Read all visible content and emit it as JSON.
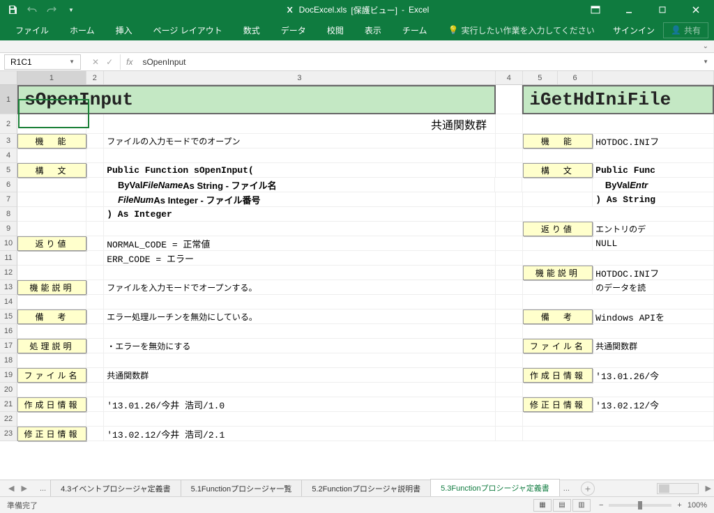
{
  "title": {
    "file": "DocExcel.xls",
    "mode": "[保護ビュー]",
    "app": "Excel"
  },
  "ribbon": {
    "file": "ファイル",
    "home": "ホーム",
    "insert": "挿入",
    "layout": "ページ レイアウト",
    "formulas": "数式",
    "data": "データ",
    "review": "校閲",
    "view": "表示",
    "team": "チーム",
    "tellme": "実行したい作業を入力してください",
    "signin": "サインイン",
    "share": "共有"
  },
  "nameBox": "R1C1",
  "formula": "sOpenInput",
  "cols": [
    "1",
    "2",
    "3",
    "4",
    "5",
    "6"
  ],
  "left": {
    "header": "sOpenInput",
    "sub": "共通関数群",
    "labels": {
      "kinou": "機　能",
      "koubun": "構　文",
      "modori": "返り値",
      "kinousetsumei": "機能説明",
      "bikou": "備　考",
      "shorisetsumei": "処理説明",
      "filename": "ファイル名",
      "sakusei": "作成日情報",
      "shusei": "修正日情報"
    },
    "r3": "ファイルの入力モードでのオープン",
    "r5": "Public Function sOpenInput(",
    "r6a": "ByVal ",
    "r6b": "FileName",
    "r6c": "  As String  - ファイル名",
    "r7a": "FileNum",
    "r7b": "       As Integer - ファイル番号",
    "r8": ") As Integer",
    "r10": "NORMAL_CODE = 正常値",
    "r11": "ERR_CODE    = エラー",
    "r13": "ファイルを入力モードでオープンする。",
    "r15": "エラー処理ルーチンを無効にしている。",
    "r17": "・エラーを無効にする",
    "r19": "共通関数群",
    "r21": "'13.01.26/今井 浩司/1.0",
    "r23": "'13.02.12/今井 浩司/2.1"
  },
  "right": {
    "header": "iGetHdIniFile",
    "labels": {
      "kinou": "機　能",
      "koubun": "構　文",
      "modori": "返り値",
      "kinousetsumei": "機能説明",
      "bikou": "備　考",
      "filename": "ファイル名",
      "sakusei": "作成日情報",
      "shusei": "修正日情報"
    },
    "r3": "HOTDOC.INIフ",
    "r5": "Public Func",
    "r6a": "ByVal ",
    "r6b": "Entr",
    "r7": ") As String",
    "r9": "エントリのデ",
    "r10": "NULL",
    "r12": "HOTDOC.INIフ",
    "r13": "のデータを読",
    "r15": "Windows APIを",
    "r17": "共通関数群",
    "r19": "'13.01.26/今",
    "r21": "'13.02.12/今"
  },
  "tabs": {
    "t1": "4.3イベントプロシージャ定義書",
    "t2": "5.1Functionプロシージャ一覧",
    "t3": "5.2Functionプロシージャ説明書",
    "t4": "5.3Functionプロシージャ定義書"
  },
  "status": "準備完了",
  "zoom": "100%"
}
